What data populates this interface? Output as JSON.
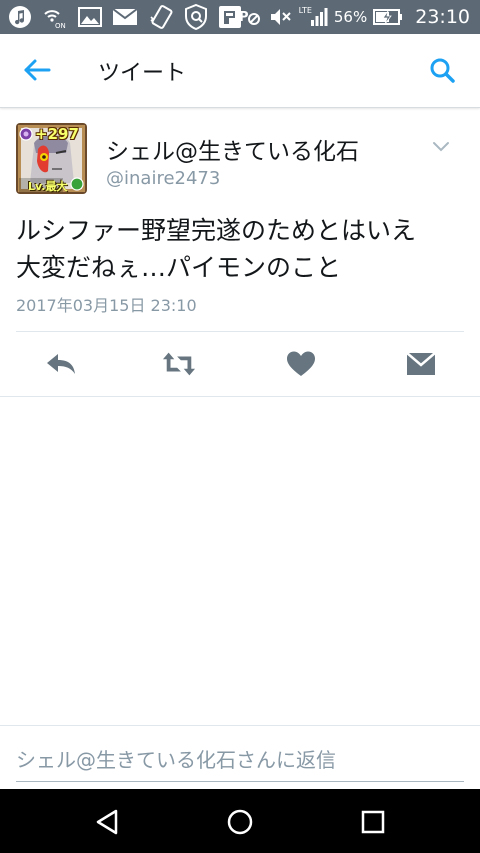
{
  "status_bar": {
    "left_icons": [
      "music-icon",
      "wifi-calling-icon",
      "image-icon",
      "mail-icon",
      "vibrate-icon",
      "vpn-icon",
      "app-icon"
    ],
    "network_label": "LTE",
    "battery_percent": "56%",
    "time": "23:10"
  },
  "header": {
    "title": "ツイート"
  },
  "tweet": {
    "avatar_overlay_text": "+297",
    "avatar_badge_text": "Lv.最大",
    "display_name": "シェル@生きている化石",
    "handle": "@inaire2473",
    "text_line1": "ルシファー野望完遂のためとはいえ",
    "text_line2": "大変だねぇ…パイモンのこと",
    "timestamp": "2017年03月15日 23:10"
  },
  "actions": [
    "reply-icon",
    "retweet-icon",
    "like-icon",
    "direct-message-icon"
  ],
  "reply": {
    "placeholder": "シェル@生きている化石さんに返信"
  },
  "colors": {
    "status_bar": "#5d6a76",
    "accent": "#1da1f2",
    "action_icon": "#66757f",
    "secondary_text": "#8899a6"
  }
}
